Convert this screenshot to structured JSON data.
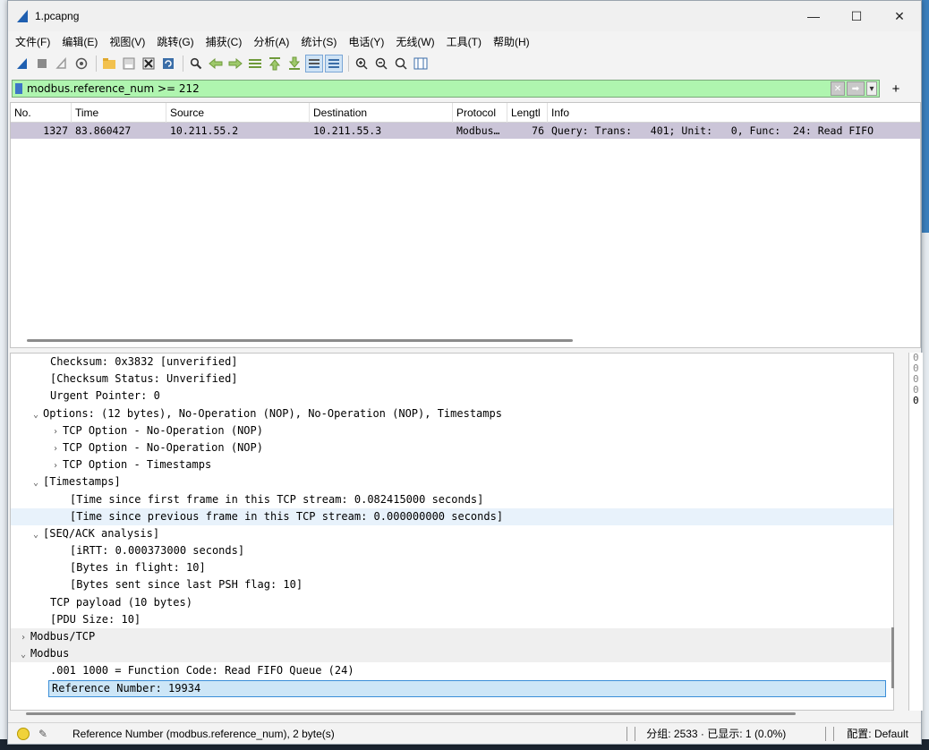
{
  "window": {
    "title": "1.pcapng",
    "minimize": "—",
    "maximize": "☐",
    "close": "✕"
  },
  "menu": [
    "文件(F)",
    "编辑(E)",
    "视图(V)",
    "跳转(G)",
    "捕获(C)",
    "分析(A)",
    "统计(S)",
    "电话(Y)",
    "无线(W)",
    "工具(T)",
    "帮助(H)"
  ],
  "toolbar": {
    "icons": [
      "shark-fin-start-icon",
      "stop-icon",
      "restart-icon",
      "options-icon",
      "open-folder-icon",
      "save-file-icon",
      "close-file-icon",
      "reload-icon",
      "find-icon",
      "back-icon",
      "forward-icon",
      "goto-packet-icon",
      "first-packet-icon",
      "last-packet-icon",
      "autoscroll-icon",
      "colorize-icon",
      "zoom-in-icon",
      "zoom-out-icon",
      "normal-size-icon",
      "resize-columns-icon"
    ]
  },
  "filter": {
    "value": "modbus.reference_num >= 212",
    "plus": "+"
  },
  "packet_list": {
    "columns": [
      "No.",
      "Time",
      "Source",
      "Destination",
      "Protocol",
      "Lengtl",
      "Info"
    ],
    "rows": [
      {
        "no": "1327",
        "time": "83.860427",
        "source": "10.211.55.2",
        "destination": "10.211.55.3",
        "protocol": "Modbus…",
        "length": "76",
        "info": "Query: Trans:   401; Unit:   0, Func:  24: Read FIFO"
      }
    ]
  },
  "details": [
    {
      "indent": 2,
      "arrow": "",
      "text": "Checksum: 0x3832 [unverified]"
    },
    {
      "indent": 2,
      "arrow": "",
      "text": "[Checksum Status: Unverified]"
    },
    {
      "indent": 2,
      "arrow": "",
      "text": "Urgent Pointer: 0"
    },
    {
      "indent": 1,
      "arrow": "v",
      "text": "Options: (12 bytes), No-Operation (NOP), No-Operation (NOP), Timestamps"
    },
    {
      "indent": 2,
      "arrow": ">",
      "text": "TCP Option - No-Operation (NOP)"
    },
    {
      "indent": 2,
      "arrow": ">",
      "text": "TCP Option - No-Operation (NOP)"
    },
    {
      "indent": 2,
      "arrow": ">",
      "text": "TCP Option - Timestamps"
    },
    {
      "indent": 1,
      "arrow": "v",
      "text": "[Timestamps]"
    },
    {
      "indent": 3,
      "arrow": "",
      "text": "[Time since first frame in this TCP stream: 0.082415000 seconds]"
    },
    {
      "indent": 3,
      "arrow": "",
      "text": "[Time since previous frame in this TCP stream: 0.000000000 seconds]"
    },
    {
      "indent": 1,
      "arrow": "v",
      "text": "[SEQ/ACK analysis]"
    },
    {
      "indent": 3,
      "arrow": "",
      "text": "[iRTT: 0.000373000 seconds]"
    },
    {
      "indent": 3,
      "arrow": "",
      "text": "[Bytes in flight: 10]"
    },
    {
      "indent": 3,
      "arrow": "",
      "text": "[Bytes sent since last PSH flag: 10]"
    },
    {
      "indent": 2,
      "arrow": "",
      "text": "TCP payload (10 bytes)"
    },
    {
      "indent": 2,
      "arrow": "",
      "text": "[PDU Size: 10]"
    },
    {
      "indent": 0,
      "arrow": ">",
      "text": "Modbus/TCP"
    },
    {
      "indent": 0,
      "arrow": "v",
      "text": "Modbus"
    },
    {
      "indent": 2,
      "arrow": "",
      "text": ".001 1000 = Function Code: Read FIFO Queue (24)"
    },
    {
      "indent": 2,
      "arrow": "",
      "text": "Reference Number: 19934"
    }
  ],
  "bytes_pane": [
    "0",
    "0",
    "0",
    "0",
    "0"
  ],
  "status": {
    "field_info": "Reference Number (modbus.reference_num), 2 byte(s)",
    "packets": "分组: 2533 · 已显示: 1 (0.0%)",
    "profile": "配置: Default"
  }
}
